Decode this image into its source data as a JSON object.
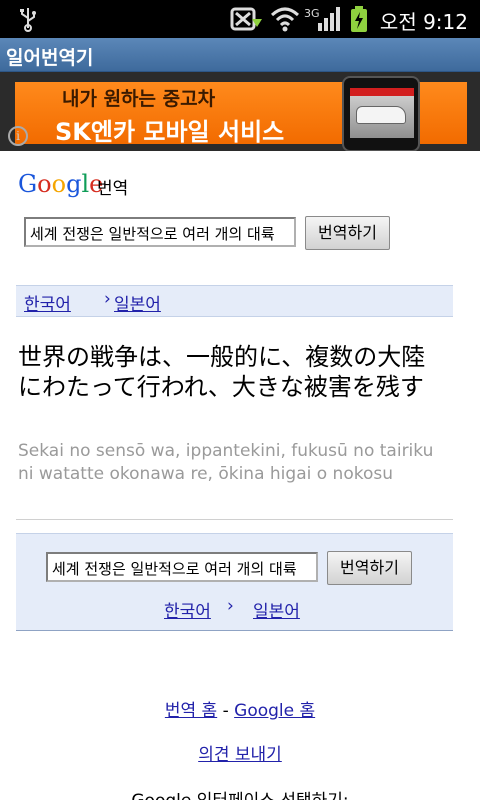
{
  "statusbar": {
    "time": "오전 9:12",
    "icons": [
      "usb-icon",
      "no-signal-sync-icon",
      "wifi-icon",
      "3g-signal-icon",
      "battery-charging-icon"
    ]
  },
  "app": {
    "title": "일어번역기"
  },
  "ad": {
    "line1": "내가 원하는 중고차",
    "line2": "SK엔카 모바일 서비스",
    "info_glyph": "i"
  },
  "google": {
    "logo": [
      "G",
      "o",
      "o",
      "g",
      "l",
      "e"
    ],
    "logo_colors": [
      "#1a56db",
      "#d62d20",
      "#f5a500",
      "#1a56db",
      "#0f9d58",
      "#d62d20"
    ],
    "header_label": "번역"
  },
  "form_top": {
    "input_value": "세계 전쟁은 일반적으로 여러 개의 대륙",
    "button_label": "번역하기"
  },
  "lang_top": {
    "source": "한국어",
    "arrow": "›",
    "target": "일본어"
  },
  "result": {
    "text": "世界の戦争は、一般的に、複数の大陸にわたって行われ、大きな被害を残す",
    "romanization": "Sekai no sensō wa, ippantekini, fukusū no tairiku ni watatte okonawa re, ōkina higai o nokosu"
  },
  "form_bottom": {
    "input_value": "세계 전쟁은 일반적으로 여러 개의 대륙",
    "button_label": "번역하기",
    "source": "한국어",
    "arrow": "›",
    "target": "일본어"
  },
  "footer": {
    "home_link": "번역 홈",
    "separator": "-",
    "google_home_link": "Google 홈",
    "feedback_link": "의견 보내기",
    "interface_label": "Google 인터페이스 선택하기:"
  }
}
